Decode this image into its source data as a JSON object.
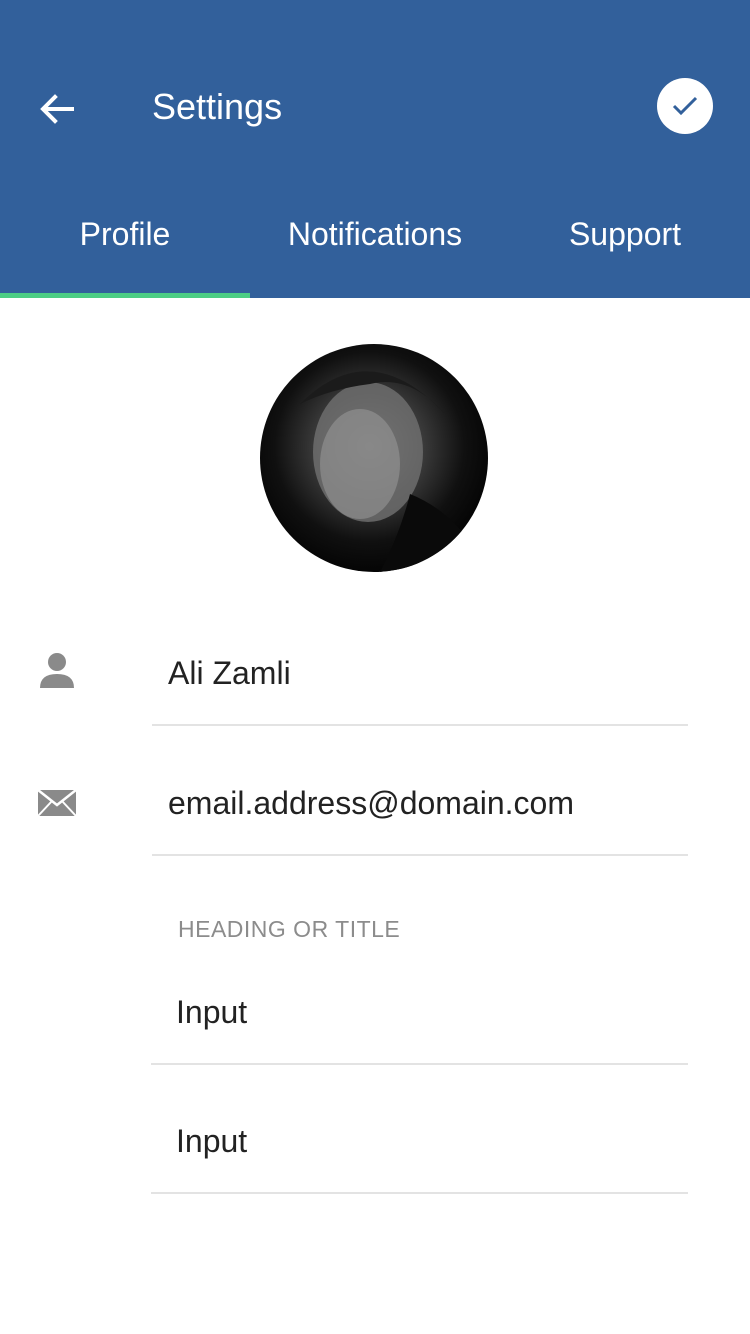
{
  "header": {
    "title": "Settings",
    "back_icon": "arrow-left-icon",
    "confirm_icon": "check-icon",
    "background_color": "#32609b"
  },
  "tabs": [
    {
      "label": "Profile",
      "active": true
    },
    {
      "label": "Notifications",
      "active": false
    },
    {
      "label": "Support",
      "active": false
    }
  ],
  "tab_indicator_color": "#4ccd84",
  "profile": {
    "name": "Ali Zamli",
    "email": "email.address@domain.com",
    "name_icon": "person-icon",
    "email_icon": "envelope-icon"
  },
  "section": {
    "heading": "HEADING OR TITLE",
    "inputs": [
      "Input",
      "Input"
    ]
  }
}
